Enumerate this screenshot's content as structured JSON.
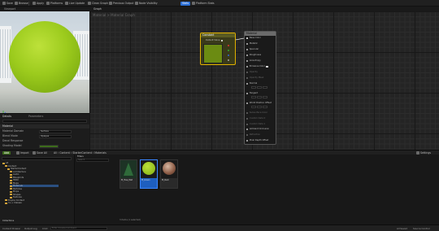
{
  "toolbar": {
    "save": "Save",
    "browse": "Browse",
    "apply": "Apply",
    "platforms": "Platforms",
    "live_update": "Live Update",
    "clean_graph": "Clean Graph",
    "previous_output": "Previous Output",
    "node_visibility": "Node Visibility",
    "toggle": "Stats",
    "platform_stats": "Platform Stats"
  },
  "tabs": [
    "Viewport",
    "Graph",
    "Material Graph"
  ],
  "breadcrumb": "Material > Material Graph",
  "details": {
    "tab_details": "Details",
    "tab_parameters": "Parameters",
    "rows": [
      "Material",
      "Material Domain",
      "Blend Mode",
      "Decal Response",
      "Shading Model"
    ],
    "domain_value": "Surface",
    "blend_value": "Opaque"
  },
  "constant_node": {
    "title": "Constant",
    "pin_label": "Default Value"
  },
  "material_node": {
    "title": "Material",
    "pins": [
      "Base Color",
      "Metallic",
      "Specular",
      "Roughness",
      "Anisotropy",
      "Emissive Color",
      "Opacity",
      "Opacity Mask",
      "Normal",
      "Tangent",
      "World Position Offset",
      "Subsurface Color",
      "Custom Data 0",
      "Custom Data 1",
      "Ambient Occlusion",
      "Refraction",
      "Pixel Depth Offset"
    ]
  },
  "content_browser": {
    "tabs": [
      "Add",
      "Import",
      "Save All"
    ],
    "path": [
      "All",
      "Content",
      "StarterContent",
      "Materials"
    ],
    "search_placeholder": "Search",
    "tree": [
      "All",
      "Content",
      "StarterContent",
      "Architecture",
      "Audio",
      "Blueprints",
      "HDRI",
      "Maps",
      "Materials",
      "Particles",
      "Props",
      "Shapes",
      "Textures",
      "Engine Content",
      "C++ Classes",
      "Collections"
    ],
    "settings_label": "Settings",
    "filter_label": "Filters",
    "item_count": "3 items (1 selected)",
    "assets": [
      {
        "label": "M_Tree_Mat",
        "kind": "tree"
      },
      {
        "label": "M_Green",
        "kind": "green"
      },
      {
        "label": "M_Rust",
        "kind": "rust"
      }
    ]
  },
  "statusbar": {
    "content_drawer": "Content Drawer",
    "output_log": "Output Log",
    "cmd": "Cmd",
    "console_placeholder": "Enter Console Command",
    "source_control": "Source Control",
    "all_saved": "All Saved"
  },
  "colors": {
    "accent": "#2b6fd6",
    "constant_border": "#e0b000",
    "sphere": "#9ccb1d"
  }
}
